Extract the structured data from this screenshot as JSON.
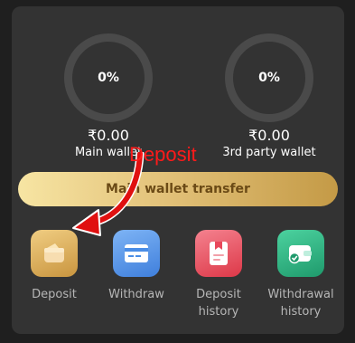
{
  "wallets": {
    "main": {
      "percent": "0%",
      "amount": "₹0.00",
      "label": "Main wallet"
    },
    "third": {
      "percent": "0%",
      "amount": "₹0.00",
      "label": "3rd party wallet"
    }
  },
  "transfer_button": {
    "label": "Main wallet transfer"
  },
  "annotation": {
    "text": "Deposit",
    "color": "#ff1a1a"
  },
  "actions": [
    {
      "label": "Deposit",
      "icon": "deposit-wallet-icon",
      "color": "#e2b55a"
    },
    {
      "label": "Withdraw",
      "icon": "withdraw-card-icon",
      "color": "#4a8de6"
    },
    {
      "label": "Deposit history",
      "icon": "deposit-history-icon",
      "color": "#e8475a"
    },
    {
      "label": "Withdrawal history",
      "icon": "withdrawal-history-icon",
      "color": "#2bb784"
    }
  ]
}
